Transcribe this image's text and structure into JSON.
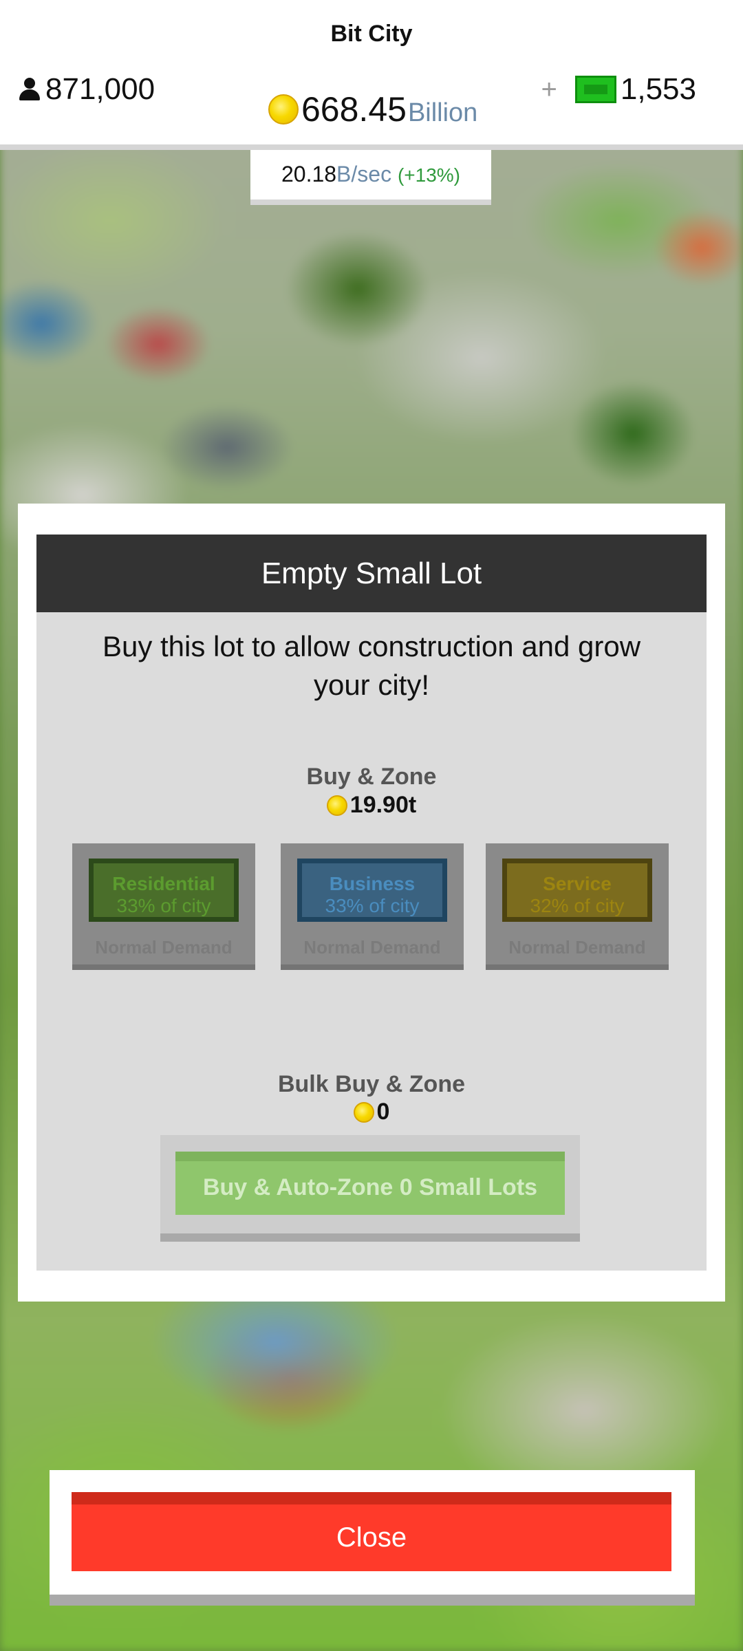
{
  "header": {
    "title": "Bit City",
    "population": "871,000",
    "money_value": "668.45",
    "money_unit": "Billion",
    "cash_plus": "+",
    "cash_value": "1,553",
    "rate_value": "20.18",
    "rate_unit": "B/sec",
    "rate_bonus": "(+13%)"
  },
  "modal": {
    "title": "Empty Small Lot",
    "description": "Buy this lot to allow construction and grow your city!",
    "buy_zone": {
      "title": "Buy & Zone",
      "price": "19.90t",
      "zones": [
        {
          "label": "Residential",
          "share": "33% of city",
          "demand": "Normal Demand"
        },
        {
          "label": "Business",
          "share": "33% of city",
          "demand": "Normal Demand"
        },
        {
          "label": "Service",
          "share": "32% of city",
          "demand": "Normal Demand"
        }
      ]
    },
    "bulk": {
      "title": "Bulk Buy & Zone",
      "price": "0",
      "button_label": "Buy & Auto-Zone 0 Small Lots"
    }
  },
  "close_label": "Close",
  "colors": {
    "close": "#ff3a2a",
    "header_bar": "#333333",
    "residential": "#4a6e2a",
    "business": "#3a6280",
    "service": "#7c6c1e",
    "bulk_button": "#8fc66c"
  }
}
